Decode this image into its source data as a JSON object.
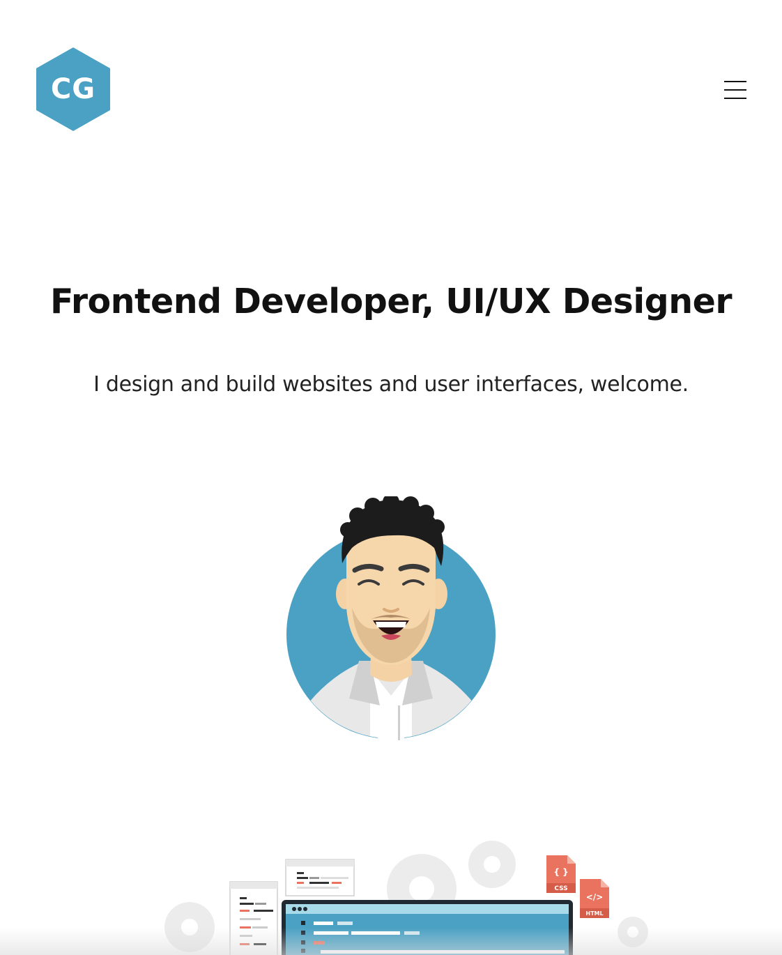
{
  "header": {
    "logo_text": "CG",
    "logo_color": "#4aa1c4",
    "menu_icon": "hamburger-icon"
  },
  "hero": {
    "title": "Frontend Developer, UI/UX Designer",
    "subtitle": "I design and build websites and user interfaces, welcome."
  },
  "illustration": {
    "css_label": "CSS",
    "css_glyph": "{ }",
    "html_label": "HTML",
    "html_glyph": "</>",
    "accent_color": "#4aa1c4",
    "file_color": "#e9735f"
  }
}
